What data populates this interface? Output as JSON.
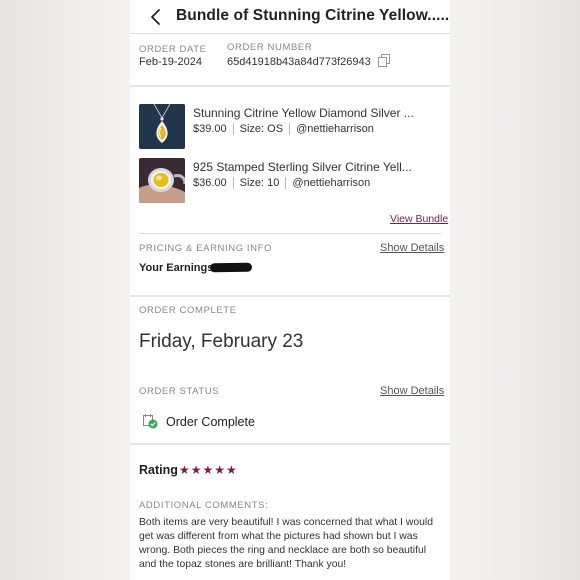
{
  "header": {
    "title": "Bundle of Stunning Citrine Yellow......"
  },
  "order": {
    "date_label": "ORDER DATE",
    "date_value": "Feb-19-2024",
    "number_label": "ORDER NUMBER",
    "number_value": "65d41918b43a84d773f26943"
  },
  "items": [
    {
      "title": "Stunning Citrine Yellow Diamond Silver ...",
      "price": "$39.00",
      "size": "Size: OS",
      "seller": "@nettieharrison"
    },
    {
      "title": "925 Stamped Sterling Silver Citrine Yell...",
      "price": "$36.00",
      "size": "Size: 10",
      "seller": "@nettieharrison"
    }
  ],
  "view_bundle": "View Bundle",
  "pricing": {
    "label": "PRICING & EARNING INFO",
    "show_details": "Show Details",
    "earnings_label": "Your Earnings:"
  },
  "complete": {
    "label": "ORDER COMPLETE",
    "date": "Friday, February 23"
  },
  "status": {
    "label": "ORDER STATUS",
    "show_details": "Show Details",
    "value": "Order Complete"
  },
  "rating": {
    "label": "Rating",
    "stars": "★★★★★",
    "value": 5
  },
  "comments": {
    "label": "ADDITIONAL COMMENTS:",
    "text": "Both items are very beautiful! I was concerned that what I would get was different from what the pictures had shown but I was wrong. Both pieces the ring and necklace are both so beautiful and the topaz stones are brilliant! Thank you!"
  },
  "colors": {
    "accent": "#7a1d4e",
    "success": "#3aa655"
  }
}
